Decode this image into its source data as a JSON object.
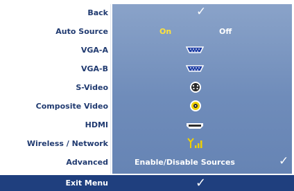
{
  "menu": {
    "rows": [
      {
        "label": "Back",
        "value_icon": "checkmark-icon"
      },
      {
        "label": "Auto Source",
        "on": "On",
        "off": "Off"
      },
      {
        "label": "VGA-A",
        "value_icon": "vga-connector-icon"
      },
      {
        "label": "VGA-B",
        "value_icon": "vga-connector-icon"
      },
      {
        "label": "S-Video",
        "value_icon": "s-video-connector-icon"
      },
      {
        "label": "Composite Video",
        "value_icon": "composite-video-connector-icon"
      },
      {
        "label": "HDMI",
        "value_icon": "hdmi-connector-icon"
      },
      {
        "label": "Wireless / Network",
        "value_icon": "wireless-network-icon"
      },
      {
        "label": "Advanced",
        "value": "Enable/Disable Sources",
        "value_icon": "checkmark-icon"
      }
    ],
    "footer": {
      "label": "Exit Menu",
      "value_icon": "checkmark-icon"
    }
  },
  "colors": {
    "panel": "#7b96c3",
    "label_text": "#203a70",
    "selected_value": "#ffe33b",
    "footer": "#1f3f7e"
  }
}
